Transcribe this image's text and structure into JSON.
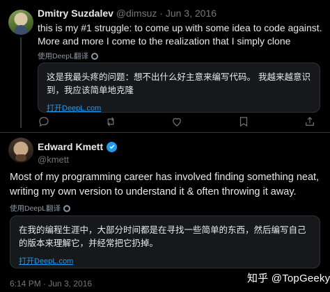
{
  "tweet1": {
    "author_name": "Dmitry Suzdalev",
    "author_handle": "@dimsuz",
    "separator": "·",
    "date": "Jun 3, 2016",
    "text": "this is my #1 struggle: to come up with some idea to code against. More and more I come to the realization that I simply clone",
    "deepl_tag": "使用DeepL翻译",
    "translation": "这是我最头疼的问题：想不出什么好主意来编写代码。 我越来越意识到，我应该简单地克隆",
    "translation_link": "打开DeepL.com"
  },
  "tweet2": {
    "author_name": "Edward Kmett",
    "author_handle": "@kmett",
    "text": "Most of my programming career has involved finding something neat, writing my own version to understand it & often throwing it away.",
    "deepl_tag": "使用DeepL翻译",
    "translation": "在我的编程生涯中，大部分时间都是在寻找一些简单的东西，然后编写自己的版本来理解它，并经常把它扔掉。",
    "translation_link": "打开DeepL.com",
    "timestamp": "6:14 PM · Jun 3, 2016"
  },
  "watermark": "知乎 @TopGeeky",
  "icons": [
    "reply-icon",
    "retweet-icon",
    "like-icon",
    "bookmark-icon",
    "share-icon",
    "verified-icon",
    "gear-icon"
  ],
  "colors": {
    "background": "#000000",
    "accent": "#1d9bf0",
    "muted": "#71767b",
    "card": "#16181c"
  }
}
